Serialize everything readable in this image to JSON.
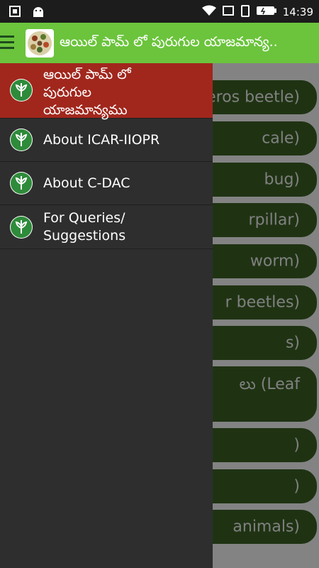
{
  "status_bar": {
    "time": "14:39",
    "icons": [
      "screenshot-icon",
      "android-icon",
      "wifi-icon",
      "screen-cast-icon",
      "battery-saver-icon",
      "battery-icon"
    ]
  },
  "app_bar": {
    "title": "ఆయిల్ పామ్ లో పురుగుల యాజమాన్య..",
    "menu_icon": "hamburger-icon"
  },
  "drawer": {
    "items": [
      {
        "label_lines": [
          "ఆయిల్ పామ్ లో",
          "పురుగుల",
          "యాజమాన్యము"
        ],
        "icon": "leaf-icon",
        "active": true
      },
      {
        "label_lines": [
          "About ICAR-IIOPR"
        ],
        "icon": "leaf-icon",
        "active": false
      },
      {
        "label_lines": [
          "About C-DAC"
        ],
        "icon": "leaf-icon",
        "active": false
      },
      {
        "label_lines": [
          "For Queries/",
          "Suggestions"
        ],
        "icon": "leaf-icon",
        "active": false
      }
    ]
  },
  "background_list": {
    "items": [
      {
        "label": "eros beetle)"
      },
      {
        "label": "cale)"
      },
      {
        "label": "bug)"
      },
      {
        "label": "rpillar)"
      },
      {
        "label": "worm)"
      },
      {
        "label": "r beetles)"
      },
      {
        "label": "s)"
      },
      {
        "label": "లు (Leaf"
      },
      {
        "label": ")"
      },
      {
        "label": ")"
      },
      {
        "label": "animals)"
      }
    ]
  },
  "colors": {
    "app_bar": "#6bc43c",
    "drawer_bg": "#2e2e2e",
    "active_item": "#a1271d",
    "list_button": "#3a5e23",
    "status_bar": "#1c1c1c"
  }
}
